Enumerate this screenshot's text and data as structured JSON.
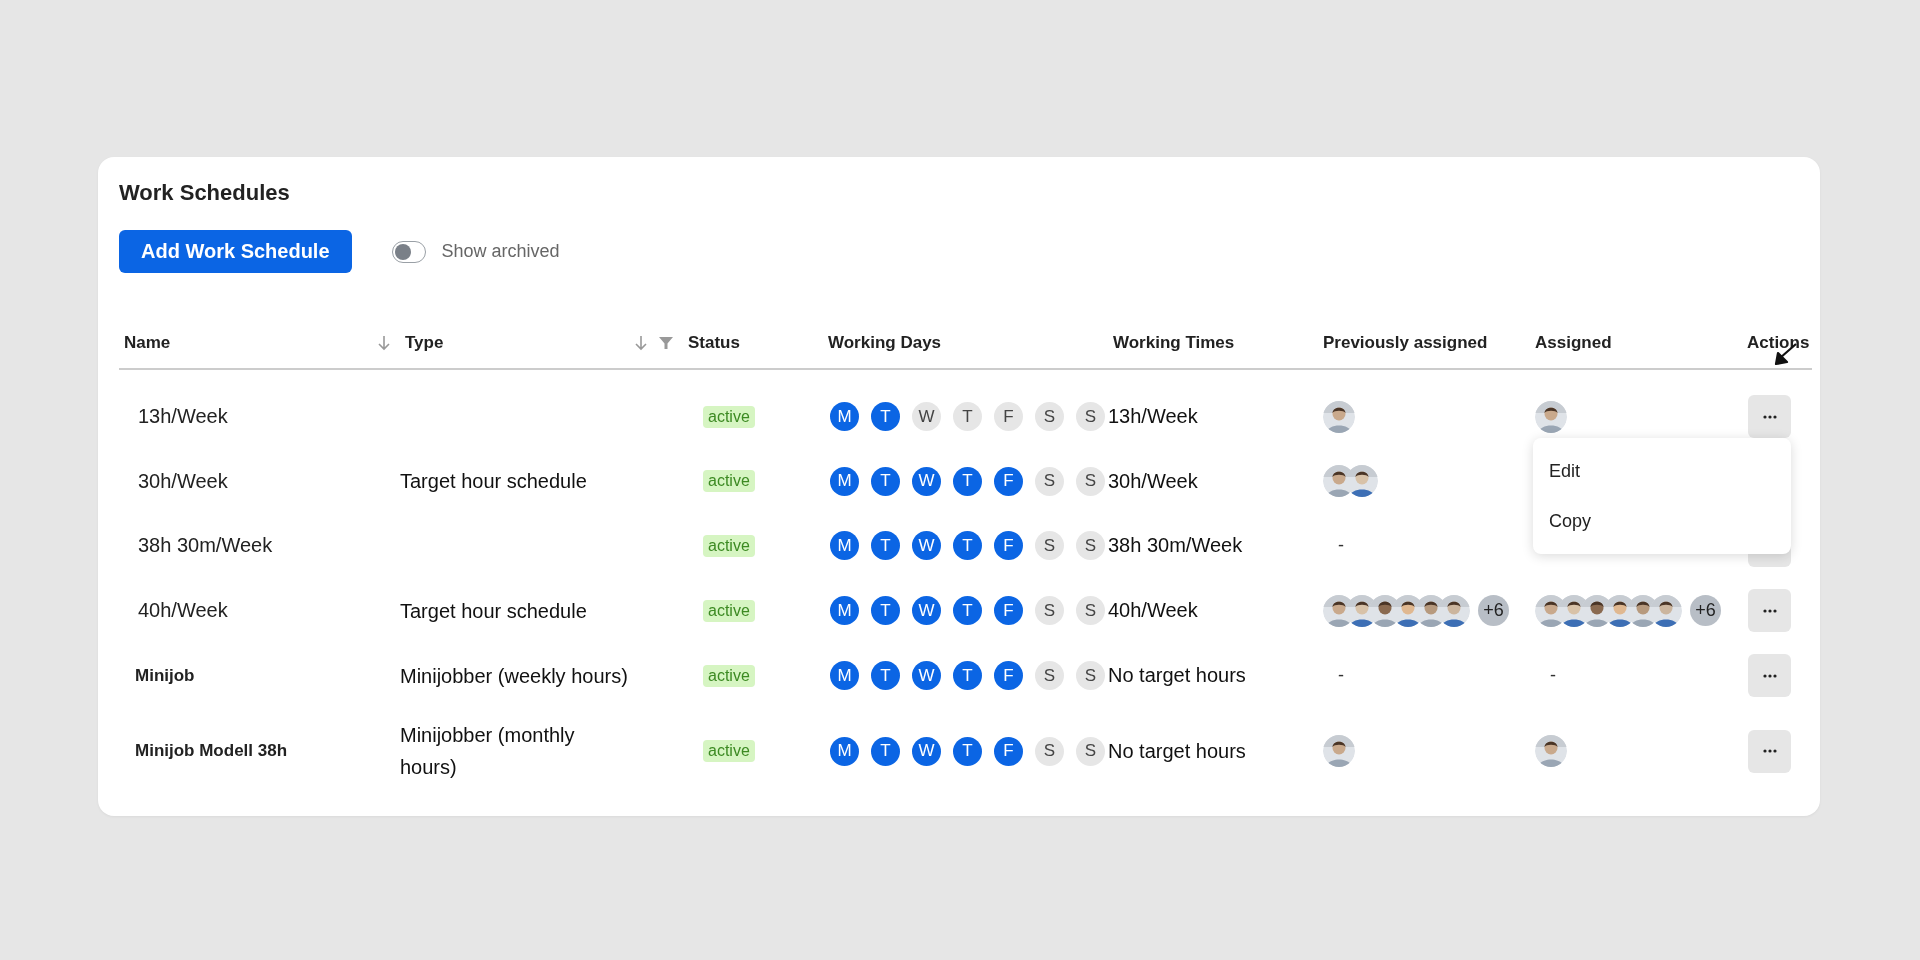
{
  "title": "Work Schedules",
  "add_button": "Add Work Schedule",
  "archived_toggle": {
    "label": "Show archived",
    "on": false
  },
  "columns": [
    {
      "label": "Name",
      "sortable": true,
      "filterable": false
    },
    {
      "label": "Type",
      "sortable": true,
      "filterable": true
    },
    {
      "label": "Status",
      "sortable": false,
      "filterable": false
    },
    {
      "label": "Working Days",
      "sortable": false,
      "filterable": false
    },
    {
      "label": "Working Times",
      "sortable": false,
      "filterable": false
    },
    {
      "label": "Previously assigned",
      "sortable": false,
      "filterable": false
    },
    {
      "label": "Assigned",
      "sortable": false,
      "filterable": false
    },
    {
      "label": "Actions",
      "sortable": false,
      "filterable": false
    }
  ],
  "rows": [
    {
      "name": "13h/Week",
      "bold": false,
      "type": "",
      "status": "active",
      "days": [
        {
          "letter": "M",
          "on": true
        },
        {
          "letter": "T",
          "on": true
        },
        {
          "letter": "W",
          "on": false
        },
        {
          "letter": "T",
          "on": false
        },
        {
          "letter": "F",
          "on": false
        },
        {
          "letter": "S",
          "on": false
        },
        {
          "letter": "S",
          "on": false
        }
      ],
      "times": "13h/Week",
      "previous": {
        "avatars": [
          {
            "kind": "picture"
          }
        ]
      },
      "assigned": {
        "avatars": [
          {
            "kind": "picture"
          }
        ]
      },
      "actions_button": true,
      "menu_open": true
    },
    {
      "name": "30h/Week",
      "bold": false,
      "type": "Target hour schedule",
      "status": "active",
      "days": [
        {
          "letter": "M",
          "on": true
        },
        {
          "letter": "T",
          "on": true
        },
        {
          "letter": "W",
          "on": true
        },
        {
          "letter": "T",
          "on": true
        },
        {
          "letter": "F",
          "on": true
        },
        {
          "letter": "S",
          "on": false
        },
        {
          "letter": "S",
          "on": false
        }
      ],
      "times": "30h/Week",
      "previous": {
        "avatars": [
          {
            "kind": "picture"
          },
          {
            "kind": "picture"
          }
        ]
      },
      "actions_button": false,
      "menu_open": false
    },
    {
      "name": "38h 30m/Week",
      "bold": false,
      "type": "",
      "status": "active",
      "days": [
        {
          "letter": "M",
          "on": true
        },
        {
          "letter": "T",
          "on": true
        },
        {
          "letter": "W",
          "on": true
        },
        {
          "letter": "T",
          "on": true
        },
        {
          "letter": "F",
          "on": true
        },
        {
          "letter": "S",
          "on": false
        },
        {
          "letter": "S",
          "on": false
        }
      ],
      "times": "38h 30m/Week",
      "previous": {
        "empty": "-"
      },
      "actions_button": true,
      "menu_open": false
    },
    {
      "name": "40h/Week",
      "bold": false,
      "type": "Target hour schedule",
      "status": "active",
      "days": [
        {
          "letter": "M",
          "on": true
        },
        {
          "letter": "T",
          "on": true
        },
        {
          "letter": "W",
          "on": true
        },
        {
          "letter": "T",
          "on": true
        },
        {
          "letter": "F",
          "on": true
        },
        {
          "letter": "S",
          "on": false
        },
        {
          "letter": "S",
          "on": false
        }
      ],
      "times": "40h/Week",
      "previous": {
        "avatars": [
          {
            "kind": "picture"
          },
          {
            "kind": "picture"
          },
          {
            "kind": "picture"
          },
          {
            "kind": "picture"
          },
          {
            "kind": "picture"
          },
          {
            "kind": "picture"
          }
        ],
        "more": "+6"
      },
      "assigned": {
        "avatars": [
          {
            "kind": "picture"
          },
          {
            "kind": "picture"
          },
          {
            "kind": "picture"
          },
          {
            "kind": "picture"
          },
          {
            "kind": "picture"
          },
          {
            "kind": "picture"
          }
        ],
        "more": "+6"
      },
      "actions_button": true,
      "menu_open": false
    },
    {
      "name": "Minijob",
      "bold": true,
      "type": "Minijobber (weekly hours)",
      "status": "active",
      "days": [
        {
          "letter": "M",
          "on": true
        },
        {
          "letter": "T",
          "on": true
        },
        {
          "letter": "W",
          "on": true
        },
        {
          "letter": "T",
          "on": true
        },
        {
          "letter": "F",
          "on": true
        },
        {
          "letter": "S",
          "on": false
        },
        {
          "letter": "S",
          "on": false
        }
      ],
      "times": "No target hours",
      "previous": {
        "empty": "-"
      },
      "assigned": {
        "empty": "-"
      },
      "actions_button": true,
      "menu_open": false
    },
    {
      "name": "Minijob Modell 38h",
      "bold": true,
      "type": "Minijobber (monthly hours)",
      "status": "active",
      "days": [
        {
          "letter": "M",
          "on": true
        },
        {
          "letter": "T",
          "on": true
        },
        {
          "letter": "W",
          "on": true
        },
        {
          "letter": "T",
          "on": true
        },
        {
          "letter": "F",
          "on": true
        },
        {
          "letter": "S",
          "on": false
        },
        {
          "letter": "S",
          "on": false
        }
      ],
      "times": "No target hours",
      "previous": {
        "avatars": [
          {
            "kind": "picture"
          }
        ]
      },
      "assigned": {
        "avatars": [
          {
            "kind": "picture"
          }
        ]
      },
      "actions_button": true,
      "menu_open": false
    }
  ],
  "menu": {
    "items": [
      "Edit",
      "Copy"
    ]
  }
}
